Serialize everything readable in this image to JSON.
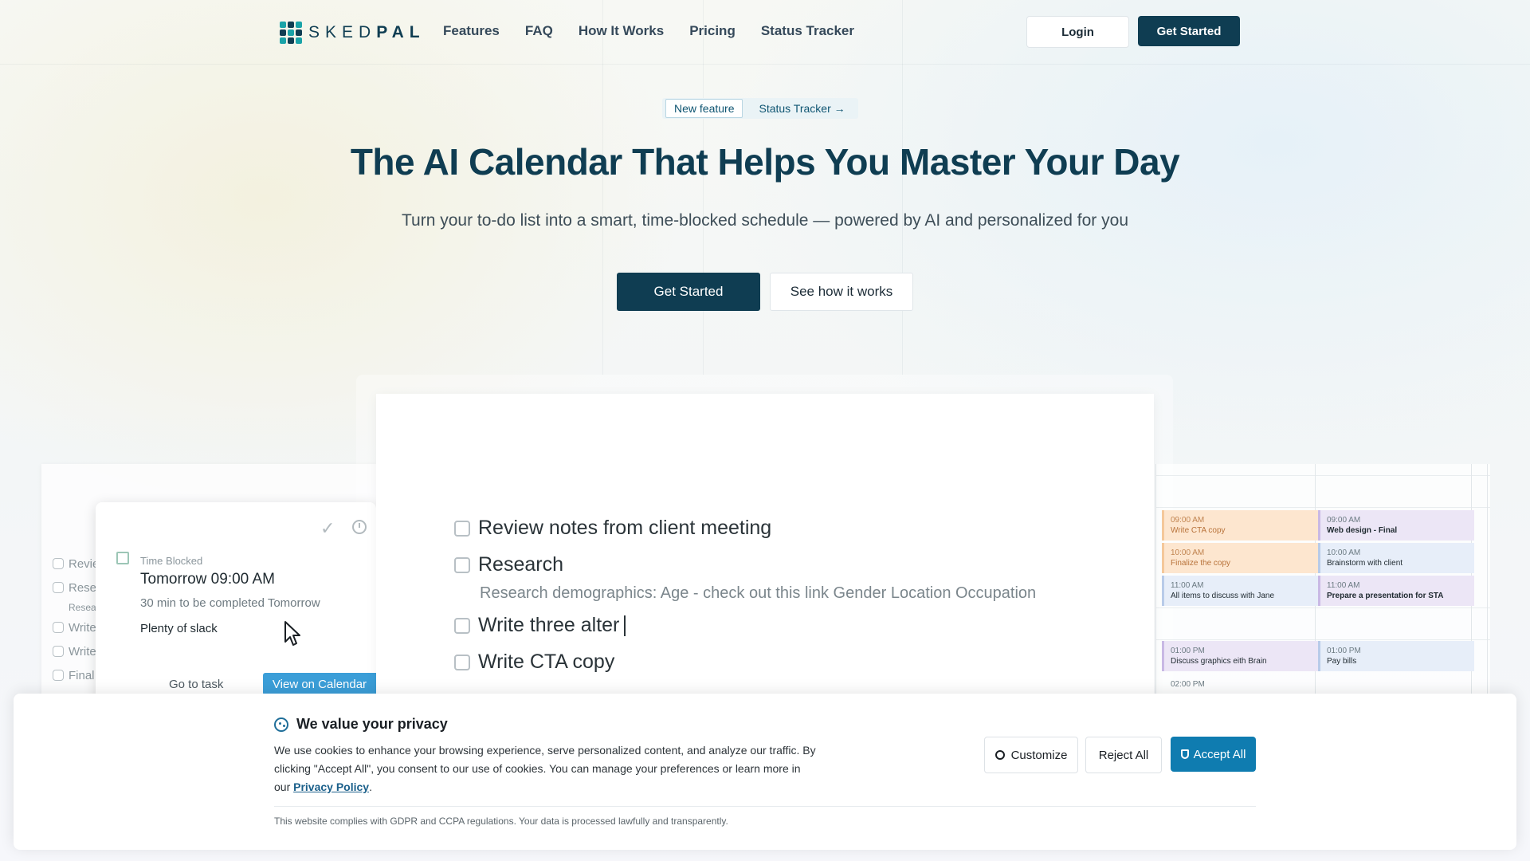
{
  "brand": {
    "logo_text_light": "SKED",
    "logo_text_bold": "PAL"
  },
  "nav": {
    "items": [
      "Features",
      "FAQ",
      "How It Works",
      "Pricing",
      "Status Tracker"
    ],
    "login": "Login",
    "get_started": "Get Started"
  },
  "hero": {
    "badge_new": "New feature",
    "badge_link": "Status Tracker →",
    "title": "The AI Calendar That Helps You Master Your Day",
    "subtitle": "Turn your to-do list into a smart, time-blocked schedule — powered by AI and personalized for you",
    "cta_primary": "Get Started",
    "cta_secondary": "See how it works"
  },
  "tasks": {
    "items": [
      "Review notes from client meeting",
      "Research",
      "Write three alter",
      "Write CTA copy"
    ],
    "research_note": "Research demographics: Age - check out this link Gender Location Occupation"
  },
  "left_list": {
    "items": [
      "Revie",
      "Rese",
      "Write",
      "Write",
      "Final"
    ],
    "sub": "Resea"
  },
  "popup": {
    "label": "Time Blocked",
    "time": "Tomorrow 09:00 AM",
    "duration": "30 min to be completed Tomorrow",
    "slack": "Plenty of slack",
    "go_task": "Go to task",
    "view_calendar": "View on Calendar"
  },
  "calendar": {
    "col1": [
      {
        "time": "09:00 AM",
        "name": "Write CTA copy"
      },
      {
        "time": "10:00 AM",
        "name": "Finalize the copy"
      },
      {
        "time": "11:00 AM",
        "name": "All items to discuss with Jane"
      },
      {
        "time": "01:00 PM",
        "name": "Discuss graphics eith Brain"
      },
      {
        "time": "02:00 PM",
        "name": ""
      }
    ],
    "col2": [
      {
        "time": "09:00 AM",
        "name": "Web design - Final"
      },
      {
        "time": "10:00 AM",
        "name": "Brainstorm with client"
      },
      {
        "time": "11:00 AM",
        "name": "Prepare a presentation for STA"
      },
      {
        "time": "01:00 PM",
        "name": "Pay bills"
      }
    ]
  },
  "cookie": {
    "title": "We value your privacy",
    "text_before": "We use cookies to enhance your browsing experience, serve personalized content, and analyze our traffic. By clicking \"Accept All\", you consent to our use of cookies. You can manage your preferences or learn more in our",
    "link": "Privacy Policy",
    "compliance": "This website complies with GDPR and CCPA regulations. Your data is processed lawfully and transparently.",
    "customize": "Customize",
    "reject": "Reject All",
    "accept": "Accept All"
  },
  "colors": {
    "brand": "#0f3d52",
    "accent": "#1aa3a8",
    "accept": "#0f7cb0",
    "view_calendar": "#3b9ed8"
  }
}
